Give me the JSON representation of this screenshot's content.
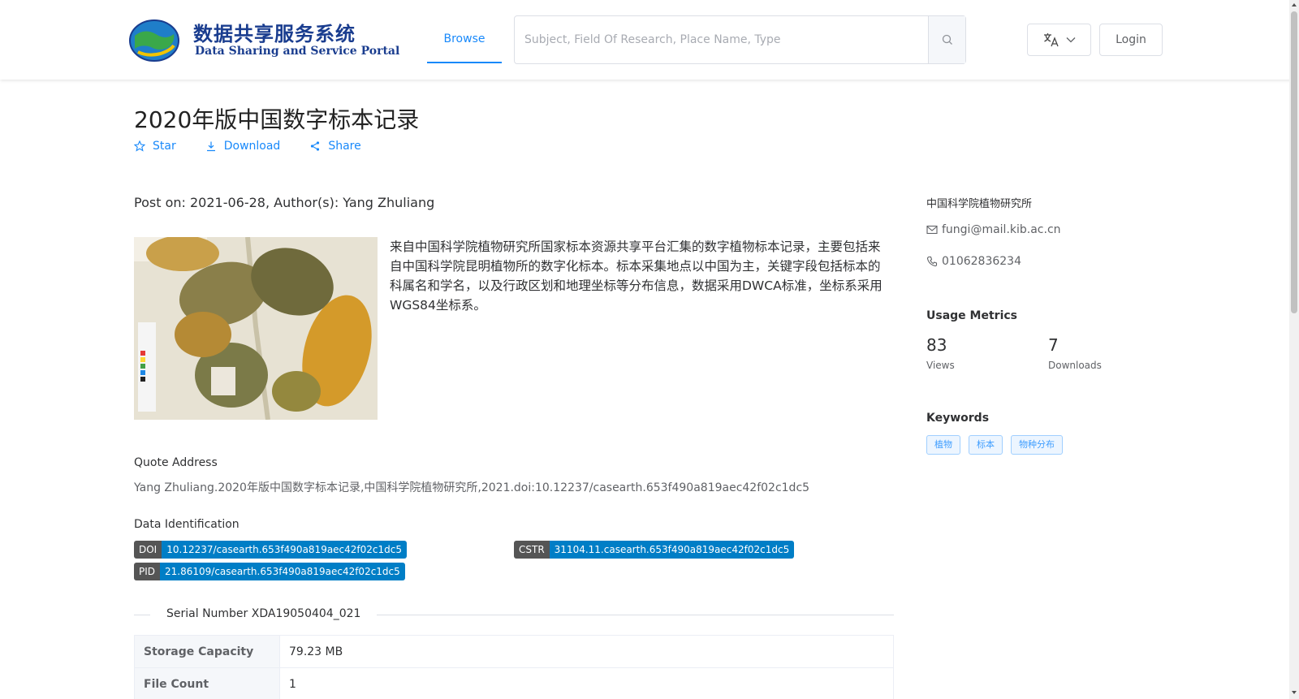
{
  "header": {
    "logo_cn": "数据共享服务系统",
    "logo_en": "Data Sharing and Service Portal",
    "nav_browse": "Browse",
    "search_placeholder": "Subject, Field Of Research, Place Name, Type",
    "language_icon": "translate-icon",
    "login_label": "Login"
  },
  "dataset": {
    "title": "2020年版中国数字标本记录",
    "actions": {
      "star": "Star",
      "download": "Download",
      "share": "Share"
    },
    "post_on": "Post on: 2021-06-28, Author(s): Yang Zhuliang",
    "description": "来自中国科学院植物研究所国家标本资源共享平台汇集的数字植物标本记录，主要包括来自中国科学院昆明植物所的数字化标本。标本采集地点以中国为主，关键字段包括标本的科属名和学名，以及行政区划和地理坐标等分布信息，数据采用DWCA标准，坐标系采用WGS84坐标系。",
    "quote_label": "Quote Address",
    "quote_text": "Yang Zhuliang.2020年版中国数字标本记录,中国科学院植物研究所,2021.doi:10.12237/casearth.653f490a819aec42f02c1dc5",
    "identification_label": "Data Identification",
    "identifiers": {
      "doi_key": "DOI",
      "doi_value": "10.12237/casearth.653f490a819aec42f02c1dc5",
      "cstr_key": "CSTR",
      "cstr_value": "31104.11.casearth.653f490a819aec42f02c1dc5",
      "pid_key": "PID",
      "pid_value": "21.86109/casearth.653f490a819aec42f02c1dc5"
    },
    "serial_number": "Serial Number XDA19050404_021",
    "info_rows": [
      {
        "label": "Storage Capacity",
        "value": "79.23 MB"
      },
      {
        "label": "File Count",
        "value": "1"
      }
    ]
  },
  "sidebar": {
    "organization": "中国科学院植物研究所",
    "email": "fungi@mail.kib.ac.cn",
    "phone": "01062836234",
    "usage_heading": "Usage Metrics",
    "views_value": "83",
    "views_label": "Views",
    "downloads_value": "7",
    "downloads_label": "Downloads",
    "keywords_heading": "Keywords",
    "keywords": [
      "植物",
      "标本",
      "物种分布"
    ]
  },
  "colors": {
    "accent": "#1989fa",
    "badge_key": "#555555",
    "badge_value": "#007ec6",
    "logo_blue": "#1a3d8f"
  }
}
